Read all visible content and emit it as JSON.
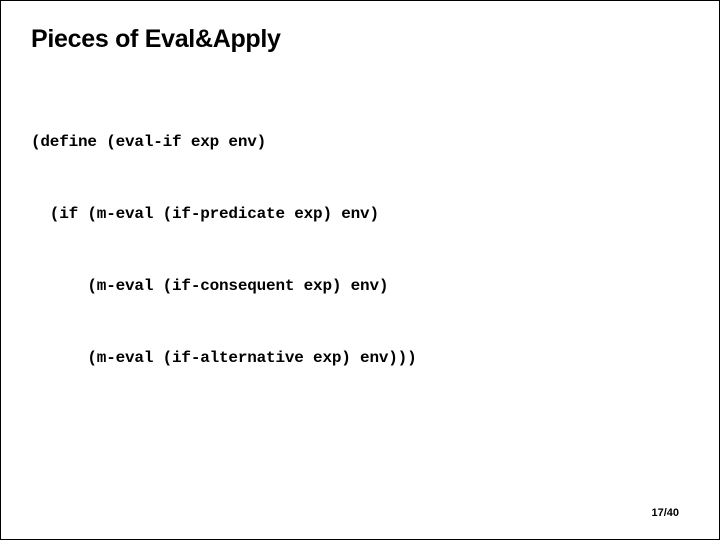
{
  "slide": {
    "title": "Pieces of Eval&Apply",
    "code": {
      "line1": "(define (eval-if exp env)",
      "line2": "  (if (m-eval (if-predicate exp) env)",
      "line3": "      (m-eval (if-consequent exp) env)",
      "line4": "      (m-eval (if-alternative exp) env)))"
    },
    "page_number": "17/40"
  }
}
